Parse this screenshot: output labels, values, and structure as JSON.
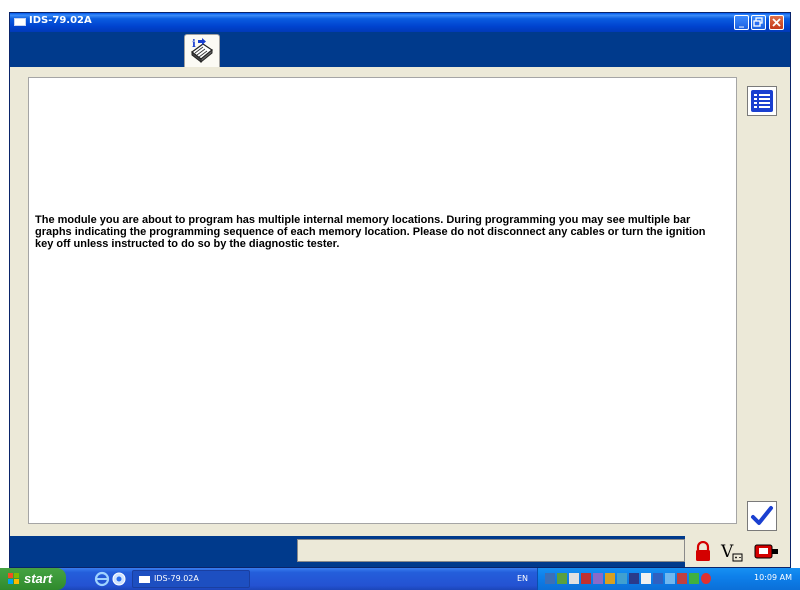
{
  "window": {
    "title": "IDS-79.02A",
    "buttons": [
      "minimize",
      "maximize",
      "close"
    ]
  },
  "toolbar": {
    "tabs": [
      {
        "icon": "info-book-icon",
        "active": true
      }
    ]
  },
  "content": {
    "message": "The module you are about to program has multiple internal memory locations.  During programming you may see multiple bar graphs indicating the programming sequence of each memory location.  Please do not disconnect any cables or turn the ignition key off unless instructed to do so by the diagnostic tester."
  },
  "side_buttons": [
    {
      "name": "list-button",
      "icon": "list-icon"
    },
    {
      "name": "confirm-button",
      "icon": "checkmark-icon"
    }
  ],
  "status_bar": {
    "icons": [
      "lock-icon",
      "battery-voltage-icon",
      "vehicle-link-icon"
    ],
    "vbatt_label": "V"
  },
  "taskbar": {
    "start_label": "start",
    "task_label": "IDS-79.02A",
    "language": "EN",
    "clock": "10:09 AM"
  },
  "colors": {
    "title_bar": "#0a5ce0",
    "toolbar": "#003a8c",
    "panel": "#ece9d8",
    "lock": "#d40000",
    "check": "#1a3fd0"
  }
}
